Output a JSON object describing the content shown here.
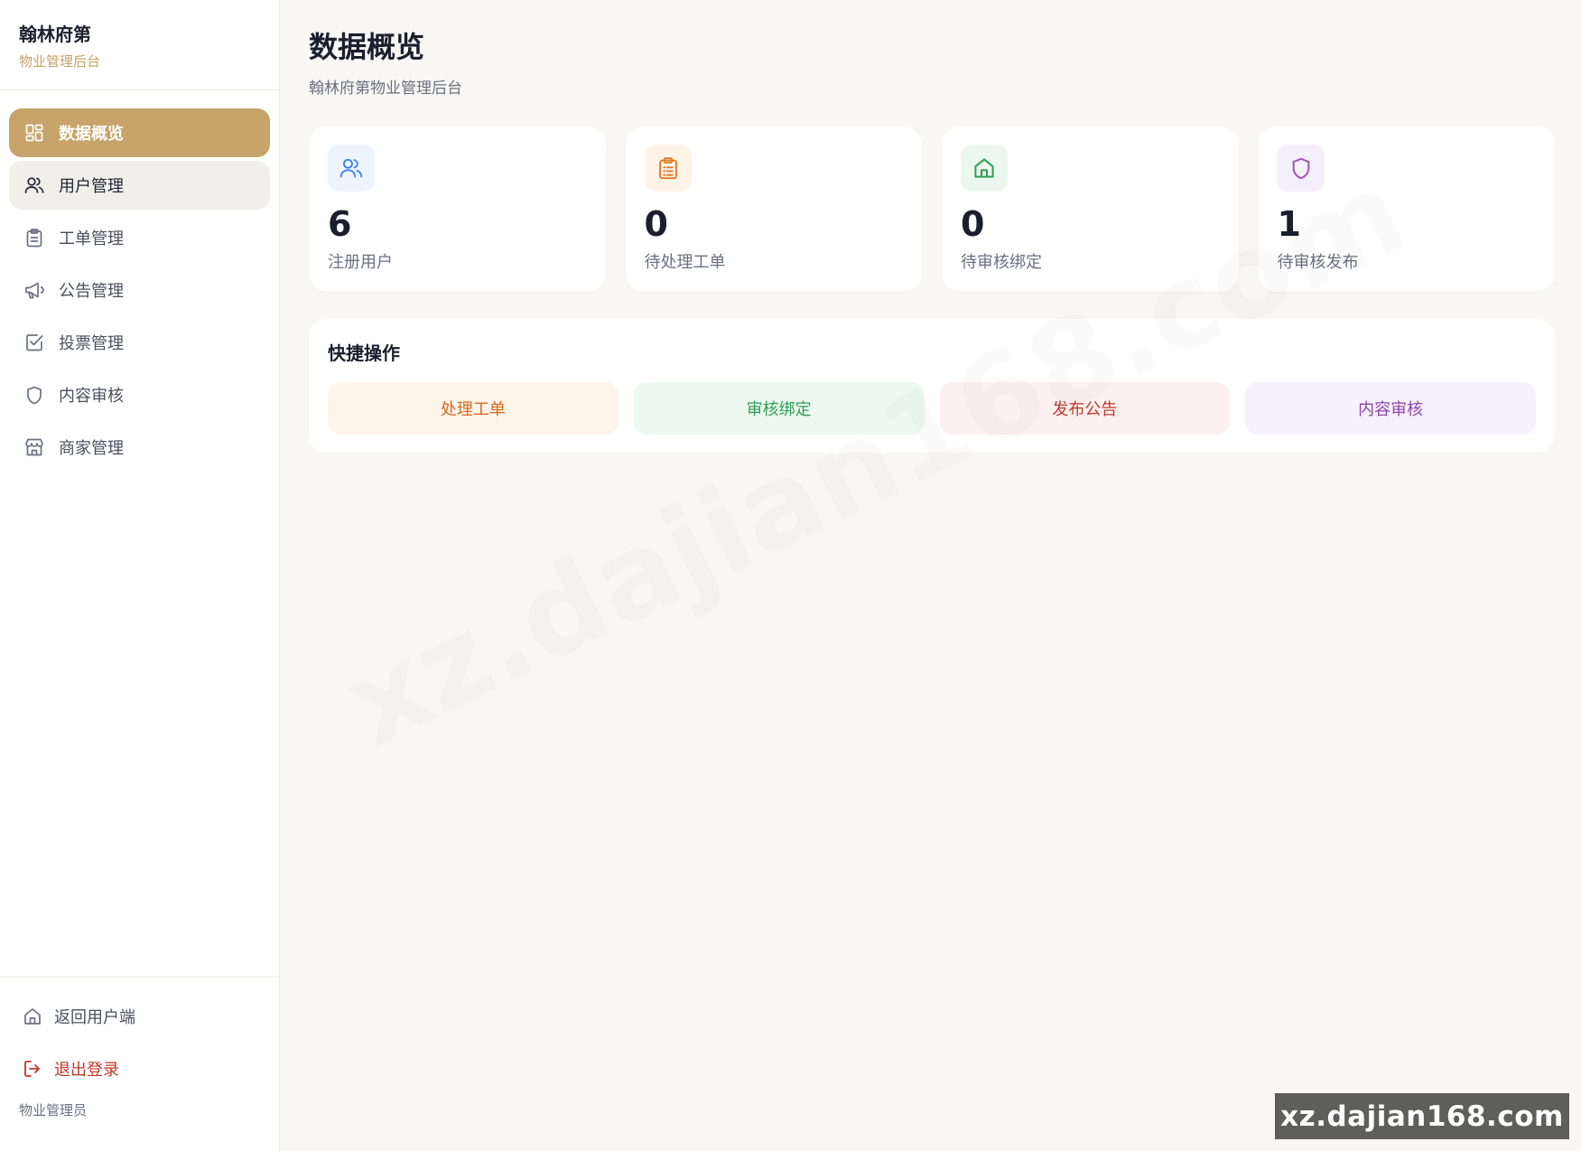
{
  "brand": {
    "title": "翰林府第",
    "subtitle": "物业管理后台"
  },
  "nav": {
    "items": [
      {
        "label": "数据概览",
        "icon": "dashboard-icon",
        "state": "active"
      },
      {
        "label": "用户管理",
        "icon": "users-icon",
        "state": "hover"
      },
      {
        "label": "工单管理",
        "icon": "clipboard-icon",
        "state": "normal"
      },
      {
        "label": "公告管理",
        "icon": "megaphone-icon",
        "state": "normal"
      },
      {
        "label": "投票管理",
        "icon": "checkbox-icon",
        "state": "normal"
      },
      {
        "label": "内容审核",
        "icon": "shield-icon",
        "state": "normal"
      },
      {
        "label": "商家管理",
        "icon": "store-icon",
        "state": "normal"
      }
    ]
  },
  "footer": {
    "back_label": "返回用户端",
    "logout_label": "退出登录",
    "role": "物业管理员"
  },
  "page": {
    "title": "数据概览",
    "subtitle": "翰林府第物业管理后台"
  },
  "stats": [
    {
      "value": "6",
      "label": "注册用户",
      "icon": "users-icon",
      "color": "#3b82f6",
      "bg": "#eef4fd"
    },
    {
      "value": "0",
      "label": "待处理工单",
      "icon": "clipboard-icon",
      "color": "#e07b24",
      "bg": "#fff3e8"
    },
    {
      "value": "0",
      "label": "待审核绑定",
      "icon": "home-icon",
      "color": "#2f9e56",
      "bg": "#ecf8ef"
    },
    {
      "value": "1",
      "label": "待审核发布",
      "icon": "shield-icon",
      "color": "#9b59b6",
      "bg": "#f5eefb"
    }
  ],
  "quick": {
    "title": "快捷操作",
    "actions": [
      {
        "label": "处理工单",
        "style": "orange"
      },
      {
        "label": "审核绑定",
        "style": "green"
      },
      {
        "label": "发布公告",
        "style": "red"
      },
      {
        "label": "内容审核",
        "style": "purple"
      }
    ]
  },
  "watermark": {
    "text": "xz.dajian168.com"
  }
}
